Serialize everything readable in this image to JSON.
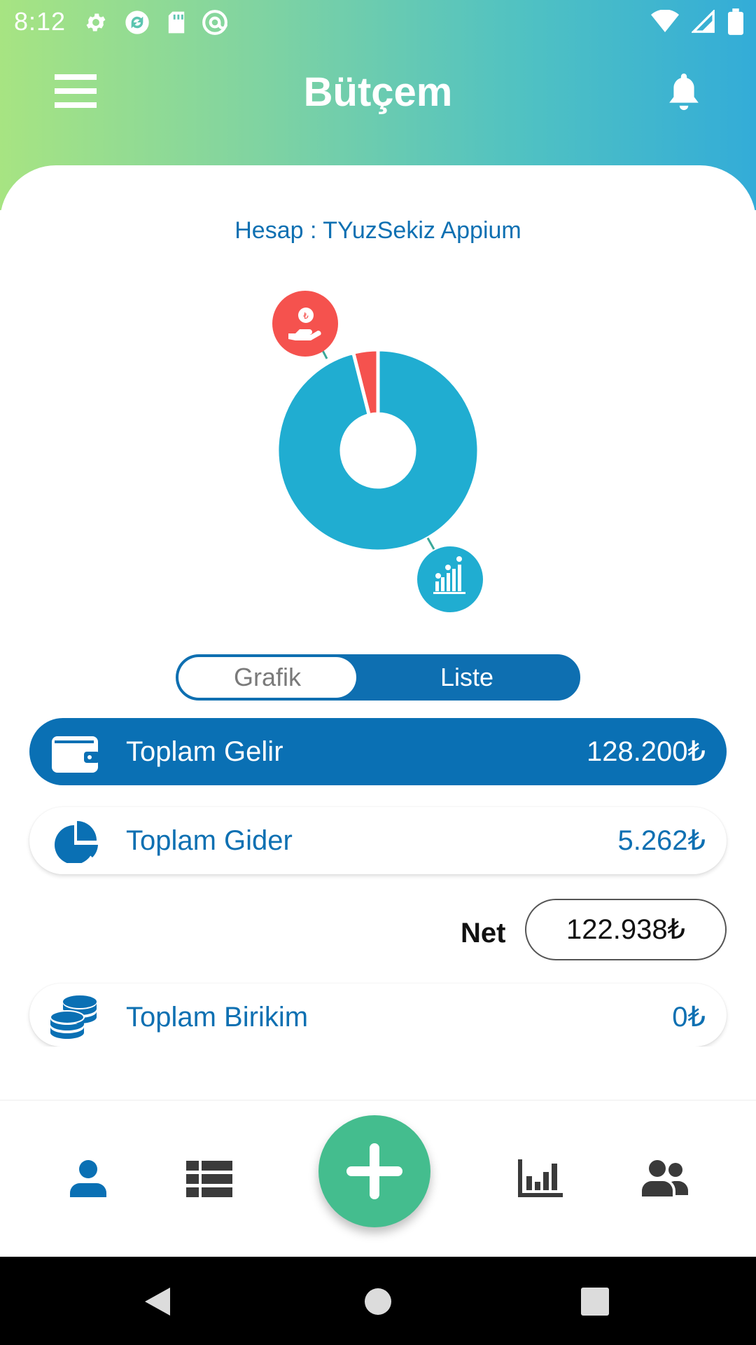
{
  "status_bar": {
    "time": "8:12",
    "left_icons": [
      "settings-icon",
      "sync-icon",
      "sd-card-icon",
      "at-sign-icon"
    ],
    "right_icons": [
      "wifi-icon",
      "cell-signal-icon",
      "battery-icon"
    ]
  },
  "header": {
    "title": "Bütçem",
    "menu_icon": "hamburger-menu-icon",
    "notification_icon": "bell-icon",
    "gradient_colors": [
      "#a7e482",
      "#33acd8"
    ]
  },
  "account": {
    "label": "Hesap : TYuzSekiz Appium"
  },
  "donut_chart": {
    "segments": [
      {
        "name": "Gider",
        "value": 5262,
        "color": "#f5524e",
        "icon": "hand-money-icon"
      },
      {
        "name": "Gelir",
        "value": 128200,
        "color": "#20add1",
        "icon": "growth-chart-icon"
      }
    ]
  },
  "view_toggle": {
    "options": [
      "Grafik",
      "Liste"
    ],
    "selected": "Grafik"
  },
  "summary": {
    "income": {
      "label": "Toplam Gelir",
      "value": "128.200₺",
      "icon": "wallet-icon"
    },
    "expense": {
      "label": "Toplam Gider",
      "value": "5.262₺",
      "icon": "pie-chart-icon"
    },
    "net": {
      "label": "Net",
      "value": "122.938₺"
    },
    "savings": {
      "label": "Toplam Birikim",
      "value": "0₺",
      "icon": "coins-stack-icon"
    }
  },
  "bottom_nav": {
    "items": [
      "user-icon",
      "list-icon",
      "add-icon",
      "bar-chart-icon",
      "users-icon"
    ],
    "active": "user-icon",
    "accent": "#0a70b4",
    "fab_color": "#44bd8e"
  },
  "system_nav": {
    "buttons": [
      "back-icon",
      "home-icon",
      "recents-icon"
    ]
  }
}
